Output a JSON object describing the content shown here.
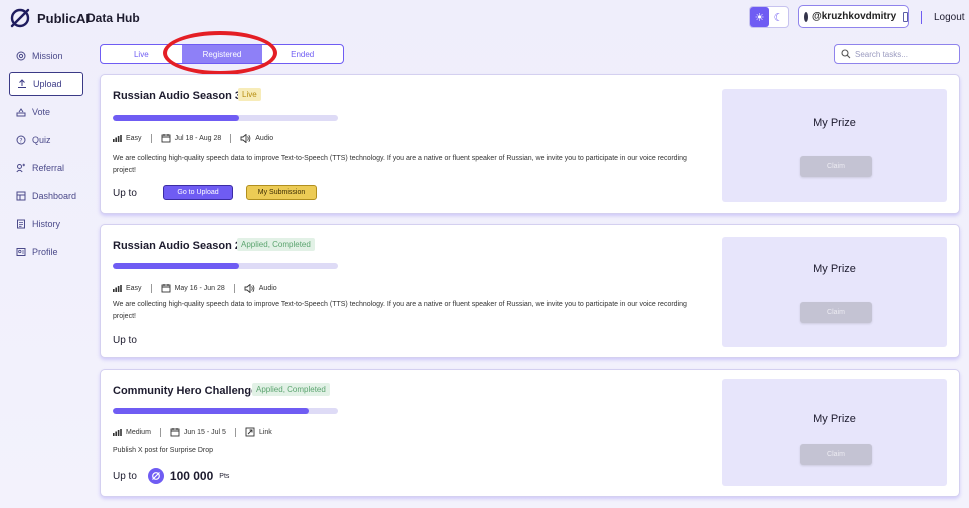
{
  "header": {
    "brand": "PublicAI",
    "section": "Data Hub",
    "username": "@kruzhkovdmitry",
    "logout": "Logout"
  },
  "sidebar": {
    "items": [
      {
        "label": "Mission",
        "icon": "target-icon"
      },
      {
        "label": "Upload",
        "icon": "upload-icon",
        "active": true
      },
      {
        "label": "Vote",
        "icon": "vote-icon"
      },
      {
        "label": "Quiz",
        "icon": "quiz-icon"
      },
      {
        "label": "Referral",
        "icon": "referral-icon"
      },
      {
        "label": "Dashboard",
        "icon": "dashboard-icon"
      },
      {
        "label": "History",
        "icon": "history-icon"
      },
      {
        "label": "Profile",
        "icon": "profile-icon"
      }
    ]
  },
  "tabs": [
    {
      "label": "Live"
    },
    {
      "label": "Registered",
      "active": true
    },
    {
      "label": "Ended"
    }
  ],
  "search": {
    "placeholder": "Search tasks..."
  },
  "tasks": [
    {
      "title": "Russian Audio Season 3",
      "status": "Live",
      "progress": 0.56,
      "difficulty": "Easy",
      "dates": "Jul 18 - Aug 28",
      "type": "Audio",
      "description": "We are collecting high-quality speech data to improve Text-to-Speech (TTS) technology. If you are a native or fluent speaker of Russian, we invite you to participate in our voice recording project!",
      "reward_label": "Up to",
      "primary_button": "Go to Upload",
      "secondary_button": "My Submission",
      "prize_title": "My Prize",
      "claim": "Claim"
    },
    {
      "title": "Russian Audio Season 2",
      "status": "Applied, Completed",
      "progress": 0.56,
      "difficulty": "Easy",
      "dates": "May 16 - Jun 28",
      "type": "Audio",
      "description": "We are collecting high-quality speech data to improve Text-to-Speech (TTS) technology. If you are a native or fluent speaker of Russian, we invite you to participate in our voice recording project!",
      "reward_label": "Up to",
      "prize_title": "My Prize",
      "claim": "Claim"
    },
    {
      "title": "Community Hero Challenge",
      "status": "Applied, Completed",
      "progress": 0.87,
      "difficulty": "Medium",
      "dates": "Jun 15 - Jul 5",
      "type": "Link",
      "description": "Publish X post for Surprise Drop",
      "reward_label": "Up to",
      "reward_value": "100 000",
      "reward_unit": "Pts",
      "prize_title": "My Prize",
      "claim": "Claim"
    }
  ]
}
